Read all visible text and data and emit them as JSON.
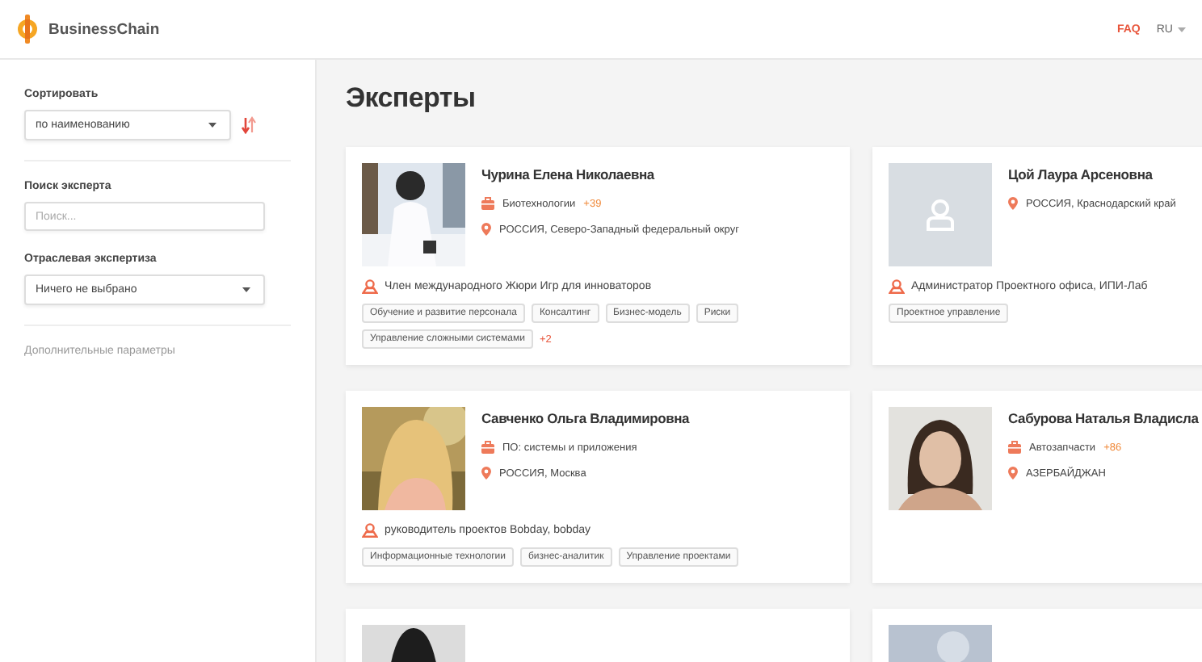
{
  "header": {
    "brand": "BusinessChain",
    "faq": "FAQ",
    "language": "RU"
  },
  "sidebar": {
    "sort": {
      "label": "Сортировать",
      "value": "по наименованию"
    },
    "search": {
      "label": "Поиск эксперта",
      "placeholder": "Поиск..."
    },
    "industry": {
      "label": "Отраслевая экспертиза",
      "value": "Ничего не выбрано"
    },
    "more_link": "Дополнительные параметры"
  },
  "page_title": "Эксперты",
  "experts": [
    {
      "photo": {
        "kind": "picture"
      },
      "name": "Чурина Елена Николаевна",
      "industry": "Биотехнологии",
      "industry_more": "+39",
      "location": "РОССИЯ, Северо-Западный федеральный округ",
      "role": "Член международного Жюри Игр для инноваторов",
      "tags": [
        "Обучение и развитие персонала",
        "Консалтинг",
        "Бизнес-модель",
        "Риски",
        "Управление сложными системами"
      ],
      "tags_more": "+2"
    },
    {
      "photo": {
        "kind": "placeholder"
      },
      "name": "Цой Лаура Арсеновна",
      "location": "РОССИЯ, Краснодарский край",
      "role": "Администратор Проектного офиса, ИПИ-Лаб",
      "tags": [
        "Проектное управление"
      ]
    },
    {
      "photo": {
        "kind": "picture"
      },
      "name": "Савченко Ольга Владимировна",
      "industry": "ПО: системы и приложения",
      "location": "РОССИЯ, Москва",
      "role": "руководитель проектов Bobday, bobday",
      "tags": [
        "Информационные технологии",
        "бизнес-аналитик",
        "Управление проектами"
      ]
    },
    {
      "photo": {
        "kind": "picture"
      },
      "name": "Сабурова Наталья Владисла",
      "industry": "Автозапчасти",
      "industry_more": "+86",
      "location": "АЗЕРБАЙДЖАН"
    },
    {
      "photo": {
        "kind": "picture"
      }
    },
    {
      "photo": {
        "kind": "picture"
      }
    }
  ]
}
